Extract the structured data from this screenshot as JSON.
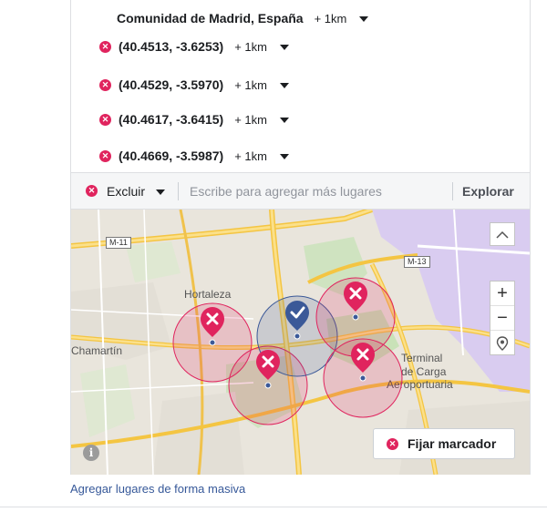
{
  "locations": [
    {
      "label": "Comunidad de Madrid, España",
      "radius": "+ 1km",
      "removable": false
    },
    {
      "label": "(40.4513, -3.6253)",
      "radius": "+ 1km",
      "removable": true
    },
    {
      "label": "(40.4529, -3.5970)",
      "radius": "+ 1km",
      "removable": true
    },
    {
      "label": "(40.4617, -3.6415)",
      "radius": "+ 1km",
      "removable": true
    },
    {
      "label": "(40.4669, -3.5987)",
      "radius": "+ 1km",
      "removable": true
    }
  ],
  "search_bar": {
    "mode_label": "Excluir",
    "placeholder": "Escribe para agregar más lugares",
    "explore_label": "Explorar"
  },
  "map": {
    "labels": {
      "hortaleza": "Hortaleza",
      "chamartin": "Chamartín",
      "terminal": "Terminal",
      "de_carga": "de Carga",
      "aeroportuaria": "Aeroportuaria"
    },
    "road_shields": {
      "m11": "M-11",
      "m13": "M-13"
    },
    "controls": {
      "zoom_in": "+",
      "zoom_out": "−",
      "collapse": "^"
    },
    "fix_marker_label": "Fijar marcador",
    "info": "i"
  },
  "footer": {
    "bulk_link": "Agregar lugares de forma masiva"
  },
  "colors": {
    "exclude": "#e0245e",
    "include_pin": "#3b5998",
    "link": "#365899"
  }
}
